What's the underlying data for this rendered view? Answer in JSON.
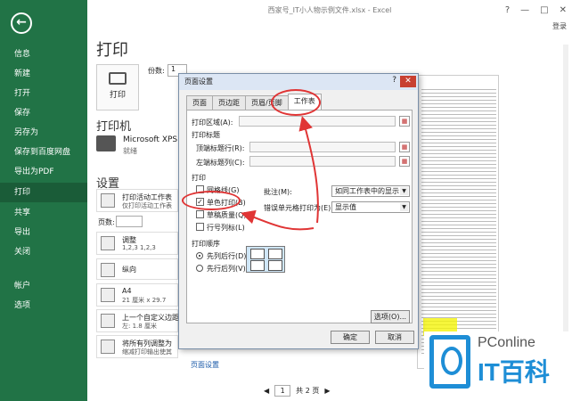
{
  "window": {
    "title": "西家号_IT小人物示例文件.xlsx - Excel",
    "login": "登录",
    "ctrl_help": "?",
    "ctrl_min": "—",
    "ctrl_max": "□",
    "ctrl_close": "✕"
  },
  "sidebar": {
    "back": "←",
    "items": [
      {
        "label": "信息"
      },
      {
        "label": "新建"
      },
      {
        "label": "打开"
      },
      {
        "label": "保存"
      },
      {
        "label": "另存为"
      },
      {
        "label": "保存到百度网盘"
      },
      {
        "label": "导出为PDF"
      },
      {
        "label": "打印"
      },
      {
        "label": "共享"
      },
      {
        "label": "导出"
      },
      {
        "label": "关闭"
      },
      {
        "label": "帐户"
      },
      {
        "label": "选项"
      }
    ]
  },
  "print": {
    "title": "打印",
    "button": "打印",
    "copies_label": "份数:",
    "copies_value": "1",
    "printer_heading": "打印机",
    "printer_name": "Microsoft XPS D",
    "printer_status": "就绪",
    "settings_heading": "设置",
    "settings": [
      {
        "main": "打印活动工作表",
        "sub": "仅打印活动工作表"
      },
      {
        "main": "调整",
        "sub": "1,2,3   1,2,3"
      },
      {
        "main": "纵向",
        "sub": ""
      },
      {
        "main": "A4",
        "sub": "21 厘米 x 29.7"
      },
      {
        "main": "上一个自定义边距",
        "sub": "左: 1.8 厘米"
      },
      {
        "main": "将所有列调整为",
        "sub": "缩减打印输出使其"
      }
    ],
    "pages_label": "页数:",
    "page_setup_link": "页面设置",
    "pager_current": "1",
    "pager_total": "共 2 页",
    "pager_prev": "◀",
    "pager_next": "▶"
  },
  "dialog": {
    "title": "页面设置",
    "help": "?",
    "close": "✕",
    "tabs": [
      "页面",
      "页边距",
      "页眉/页脚",
      "工作表"
    ],
    "print_area_label": "打印区域(A):",
    "print_titles_label": "打印标题",
    "top_rows_label": "顶端标题行(R):",
    "left_cols_label": "左端标题列(C):",
    "print_group_label": "打印",
    "gridlines_label": "网格线(G)",
    "single_color_label": "单色打印(B)",
    "single_color_checked": true,
    "draft_label": "草稿质量(Q)",
    "rowcol_label": "行号列标(L)",
    "comments_label": "批注(M):",
    "comments_value": "如同工作表中的显示",
    "errors_label": "错误单元格打印为(E):",
    "errors_value": "显示值",
    "order_label": "打印顺序",
    "order_down_label": "先列后行(D)",
    "order_over_label": "先行后列(V)",
    "order_selected": "down",
    "options_button": "选项(O)...",
    "ok_button": "确定",
    "cancel_button": "取消"
  },
  "logo": {
    "top": "PConline",
    "bottom": "IT百科"
  },
  "colors": {
    "sidebar": "#217346",
    "annotation": "#e03535",
    "logo": "#1e8ed6"
  }
}
